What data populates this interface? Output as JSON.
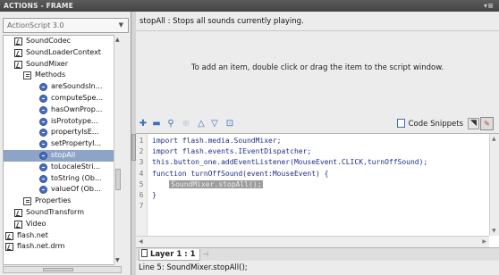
{
  "panel": {
    "title": "ACTIONS - FRAME",
    "menu_glyph": "▾≡"
  },
  "toolbox": {
    "selected_version": "ActionScript 3.0",
    "items": [
      {
        "label": "SoundCodec",
        "icon": "class-book-icon",
        "indent": 1
      },
      {
        "label": "SoundLoaderContext",
        "icon": "class-book-icon",
        "indent": 1
      },
      {
        "label": "SoundMixer",
        "icon": "class-book-icon",
        "indent": 1
      },
      {
        "label": "Methods",
        "icon": "folder-icon",
        "indent": 2
      },
      {
        "label": "areSoundsIn...",
        "icon": "method-icon",
        "indent": 3
      },
      {
        "label": "computeSpe...",
        "icon": "method-icon",
        "indent": 3
      },
      {
        "label": "hasOwnProp...",
        "icon": "method-icon",
        "indent": 3
      },
      {
        "label": "isPrototype...",
        "icon": "method-icon",
        "indent": 3
      },
      {
        "label": "propertyIsE...",
        "icon": "method-icon",
        "indent": 3
      },
      {
        "label": "setPropertyI...",
        "icon": "method-icon",
        "indent": 3
      },
      {
        "label": "stopAll",
        "icon": "method-icon",
        "indent": 3,
        "selected": true
      },
      {
        "label": "toLocaleStri...",
        "icon": "method-icon",
        "indent": 3
      },
      {
        "label": "toString (Ob...",
        "icon": "method-icon",
        "indent": 3
      },
      {
        "label": "valueOf (Ob...",
        "icon": "method-icon",
        "indent": 3
      },
      {
        "label": "Properties",
        "icon": "folder-icon",
        "indent": 2
      },
      {
        "label": "SoundTransform",
        "icon": "class-book-icon",
        "indent": 1
      },
      {
        "label": "Video",
        "icon": "class-book-icon",
        "indent": 1
      },
      {
        "label": "flash.net",
        "icon": "package-book-icon",
        "indent": 0
      },
      {
        "label": "flash.net.drm",
        "icon": "package-book-icon",
        "indent": 0
      }
    ]
  },
  "editor": {
    "description": "stopAll : Stops all sounds currently playing.",
    "hint": "To add an item, double click or drag the item to the script window.",
    "code_snippets_label": "Code Snippets",
    "lines": [
      {
        "num": "1",
        "text": "import flash.media.SoundMixer;"
      },
      {
        "num": "2",
        "text": "import flash.events.IEventDispatcher;"
      },
      {
        "num": "3",
        "text": "this.button_one.addEventListener(MouseEvent.CLICK,turnOffSound);"
      },
      {
        "num": "4",
        "text": "function turnOffSound(event:MouseEvent) {"
      },
      {
        "num": "5",
        "text": "    ",
        "highlight": "SoundMixer.stopAll();"
      },
      {
        "num": "6",
        "text": "}"
      },
      {
        "num": "7",
        "text": ""
      }
    ],
    "layer_tab": "Layer 1 : 1",
    "status": "Line 5: SoundMixer.stopAll();"
  },
  "colors": {
    "header_bg": "#4d4d4d",
    "selection": "#8da4c8",
    "code_blue": "#1f2e8a",
    "highlight_bg": "#9d9d9d"
  }
}
